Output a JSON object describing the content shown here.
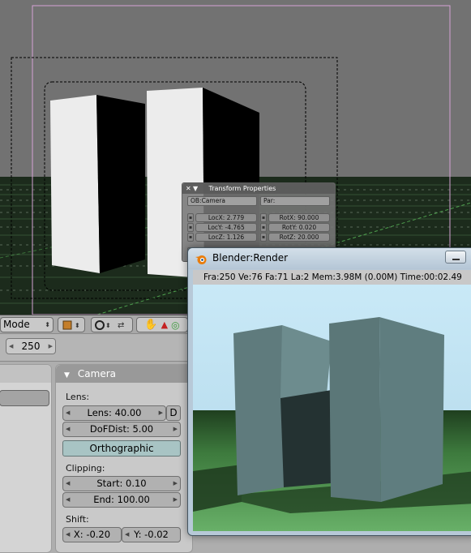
{
  "transform_properties": {
    "title": "Transform Properties",
    "object_name": "OB:Camera",
    "parent_label": "Par:",
    "loc_x": "LocX: 2.779",
    "loc_y": "LocY: -4.765",
    "loc_z": "LocZ: 1.126",
    "rot_x": "RotX: 90.000",
    "rot_y": "RotY: 0.020",
    "rot_z": "RotZ: 20.000"
  },
  "header": {
    "mode_label": "Mode"
  },
  "frame": {
    "current_frame": "250"
  },
  "camera_panel": {
    "title": "Camera",
    "lens_label": "Lens:",
    "lens_value": "Lens: 40.00",
    "lens_d_button": "D",
    "dof_dist": "DoFDist: 5.00",
    "orthographic_button": "Orthographic",
    "clipping_label": "Clipping:",
    "clip_start": "Start: 0.10",
    "clip_end": "End: 100.00",
    "shift_label": "Shift:",
    "shift_x": "X: -0.20",
    "shift_y": "Y: -0.02"
  },
  "render_window": {
    "title": "Blender:Render",
    "info": "Fra:250  Ve:76 Fa:71  La:2 Mem:3.98M (0.00M) Time:00:02.49"
  },
  "colors": {
    "viewport_bg": "#727272",
    "ground_dark": "#1c2b1c",
    "render_sky": "#c8e6f5",
    "render_ground": "#5fa35f",
    "building": "#5f7d7f"
  }
}
